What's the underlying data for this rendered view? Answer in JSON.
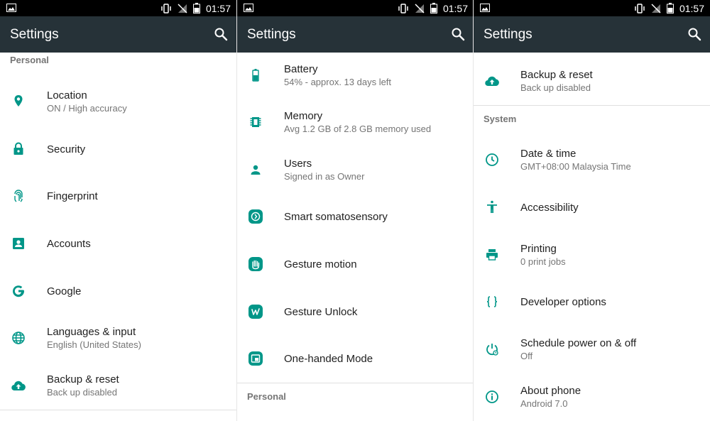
{
  "status": {
    "time": "01:57"
  },
  "accent": "#009688",
  "panel1": {
    "title": "Settings",
    "section_personal": "Personal",
    "items": [
      {
        "title": "Location",
        "sub": "ON / High accuracy",
        "icon": "location-pin-icon"
      },
      {
        "title": "Security",
        "sub": "",
        "icon": "lock-icon"
      },
      {
        "title": "Fingerprint",
        "sub": "",
        "icon": "fingerprint-icon"
      },
      {
        "title": "Accounts",
        "sub": "",
        "icon": "account-box-icon"
      },
      {
        "title": "Google",
        "sub": "",
        "icon": "google-icon"
      },
      {
        "title": "Languages & input",
        "sub": "English (United States)",
        "icon": "globe-icon"
      },
      {
        "title": "Backup & reset",
        "sub": "Back up disabled",
        "icon": "cloud-upload-icon"
      }
    ]
  },
  "panel2": {
    "title": "Settings",
    "section_personal": "Personal",
    "items": [
      {
        "title": "Battery",
        "sub": "54% - approx. 13 days left",
        "icon": "battery-icon"
      },
      {
        "title": "Memory",
        "sub": "Avg 1.2 GB of 2.8 GB memory used",
        "icon": "memory-chip-icon"
      },
      {
        "title": "Users",
        "sub": "Signed in as Owner",
        "icon": "person-icon"
      },
      {
        "title": "Smart somatosensory",
        "sub": "",
        "icon": "somatosensory-icon"
      },
      {
        "title": "Gesture motion",
        "sub": "",
        "icon": "hand-icon"
      },
      {
        "title": "Gesture Unlock",
        "sub": "",
        "icon": "gesture-unlock-icon"
      },
      {
        "title": "One-handed Mode",
        "sub": "",
        "icon": "one-handed-icon"
      }
    ]
  },
  "panel3": {
    "title": "Settings",
    "section_system": "System",
    "items": [
      {
        "title": "Backup & reset",
        "sub": "Back up disabled",
        "icon": "cloud-upload-icon"
      },
      {
        "title": "Date & time",
        "sub": "GMT+08:00 Malaysia Time",
        "icon": "clock-icon"
      },
      {
        "title": "Accessibility",
        "sub": "",
        "icon": "accessibility-icon"
      },
      {
        "title": "Printing",
        "sub": "0 print jobs",
        "icon": "printer-icon"
      },
      {
        "title": "Developer options",
        "sub": "",
        "icon": "braces-icon"
      },
      {
        "title": "Schedule power on & off",
        "sub": "Off",
        "icon": "power-schedule-icon"
      },
      {
        "title": "About phone",
        "sub": "Android 7.0",
        "icon": "info-icon"
      }
    ]
  }
}
